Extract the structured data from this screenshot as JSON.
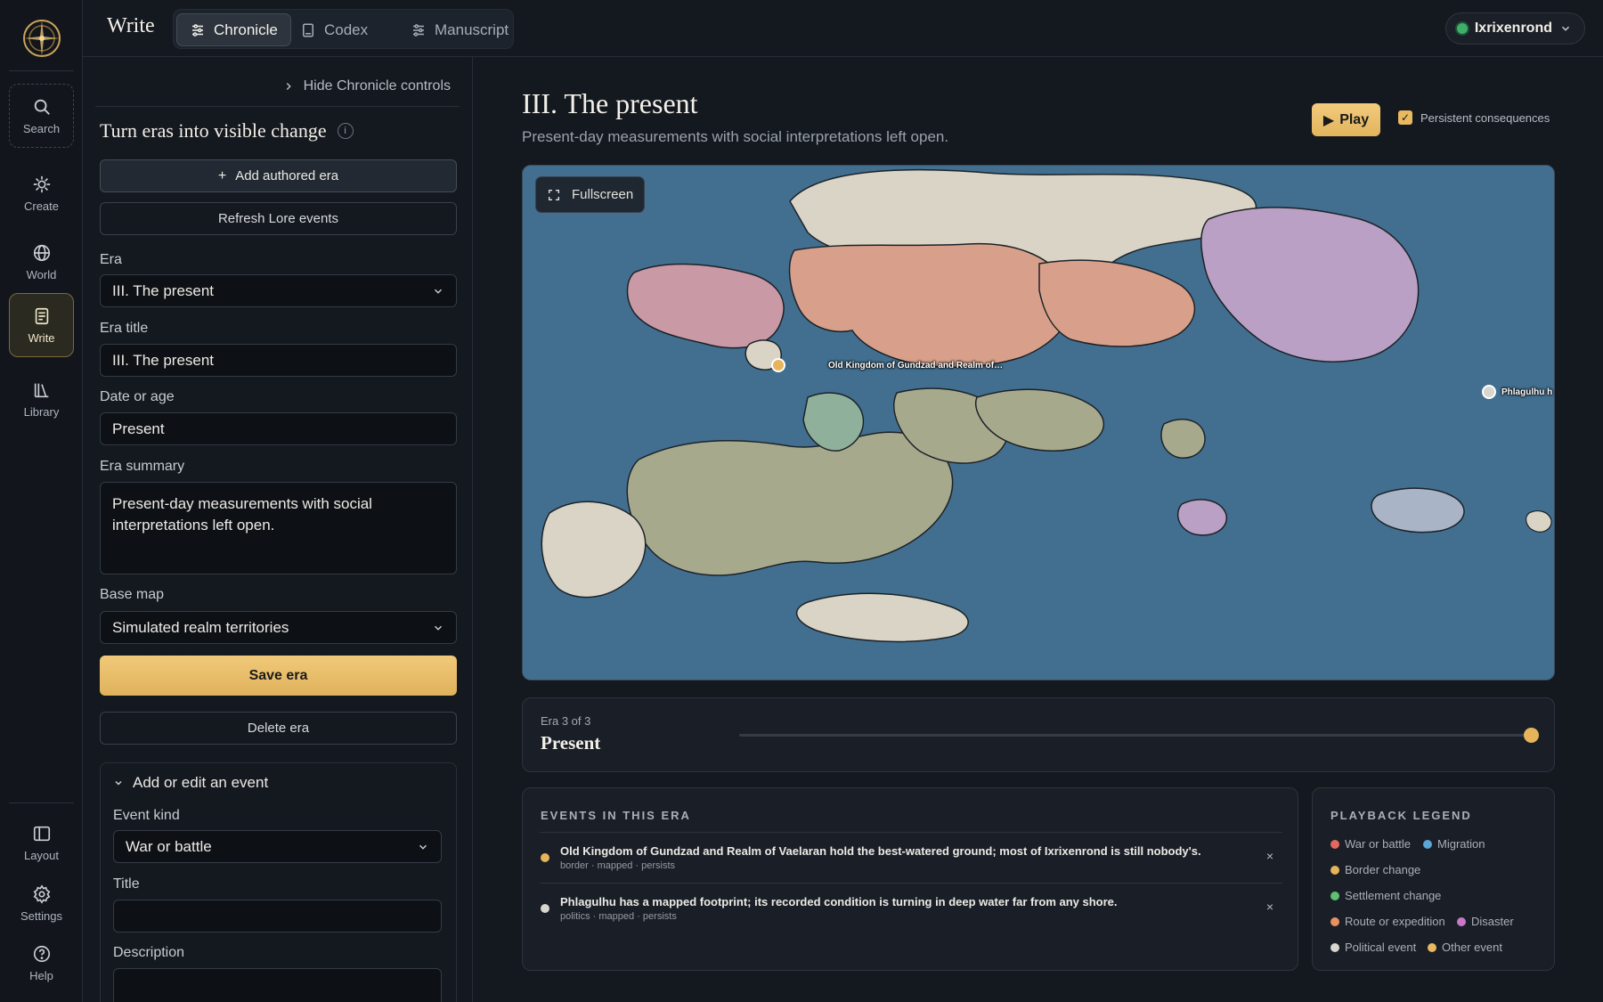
{
  "app": {
    "title": "Write"
  },
  "tabs": [
    {
      "label": "Chronicle",
      "icon": "sliders-icon",
      "active": true
    },
    {
      "label": "Codex",
      "icon": "book-icon",
      "active": false
    },
    {
      "label": "Manuscript",
      "icon": "sliders-icon",
      "active": false
    }
  ],
  "user": {
    "name": "Ixrixenrond",
    "status_color": "#3fae6b"
  },
  "rail": {
    "items": [
      {
        "label": "Search",
        "icon": "search-icon"
      },
      {
        "label": "Create",
        "icon": "sparkle-icon"
      },
      {
        "label": "World",
        "icon": "globe-icon"
      },
      {
        "label": "Write",
        "icon": "document-icon"
      },
      {
        "label": "Library",
        "icon": "library-icon"
      }
    ],
    "bottom": [
      {
        "label": "Layout",
        "icon": "layout-icon"
      },
      {
        "label": "Settings",
        "icon": "gear-icon"
      },
      {
        "label": "Help",
        "icon": "help-icon"
      }
    ]
  },
  "panel": {
    "hide_controls": "Hide Chronicle controls",
    "heading": "Turn eras into visible change",
    "info_glyph": "i",
    "add_era": "Add authored era",
    "refresh": "Refresh Lore events",
    "era_label": "Era",
    "era_value": "III. The present",
    "era_title_label": "Era title",
    "era_title_value": "III. The present",
    "date_label": "Date or age",
    "date_value": "Present",
    "summary_label": "Era summary",
    "summary_value": "Present-day measurements with social interpretations left open.",
    "base_map_label": "Base map",
    "base_map_value": "Simulated realm territories",
    "save": "Save era",
    "delete": "Delete era",
    "event_section": "Add or edit an event",
    "event_kind_label": "Event kind",
    "event_kind_value": "War or battle",
    "title_label": "Title",
    "title_value": "",
    "description_label": "Description",
    "description_value": ""
  },
  "main": {
    "era_title": "III. The present",
    "era_subtitle": "Present-day measurements with social interpretations left open.",
    "play": "Play",
    "persistent": "Persistent consequences",
    "persistent_checked": true
  },
  "map": {
    "fullscreen": "Fullscreen",
    "markers": [
      {
        "label": "Old Kingdom of Gundzad and Realm of…",
        "color": "#e6b45a"
      },
      {
        "label": "Phlagulhu h",
        "color": "#d9d6cf"
      }
    ]
  },
  "timeline": {
    "era_count": "Era 3 of 3",
    "era_name": "Present",
    "position": 1.0
  },
  "events": {
    "title": "EVENTS IN THIS ERA",
    "items": [
      {
        "title": "Old Kingdom of Gundzad and Realm of Vaelaran hold the best-watered ground; most of Ixrixenrond is still nobody's.",
        "meta": "border · mapped · persists",
        "color": "#e6b45a",
        "remove": "×"
      },
      {
        "title": "Phlagulhu has a mapped footprint; its recorded condition is turning in deep water far from any shore.",
        "meta": "politics · mapped · persists",
        "color": "#d9d6cf",
        "remove": "×"
      }
    ]
  },
  "legend": {
    "title": "PLAYBACK LEGEND",
    "items": [
      {
        "label": "War or battle",
        "color": "#e06a5f"
      },
      {
        "label": "Migration",
        "color": "#5aa7d6"
      },
      {
        "label": "Border change",
        "color": "#e6b45a"
      },
      {
        "label": "Settlement change",
        "color": "#5fbf72"
      },
      {
        "label": "Route or expedition",
        "color": "#e89160"
      },
      {
        "label": "Disaster",
        "color": "#c978c9"
      },
      {
        "label": "Political event",
        "color": "#d9d6cf"
      },
      {
        "label": "Other event",
        "color": "#e8b960"
      }
    ]
  }
}
